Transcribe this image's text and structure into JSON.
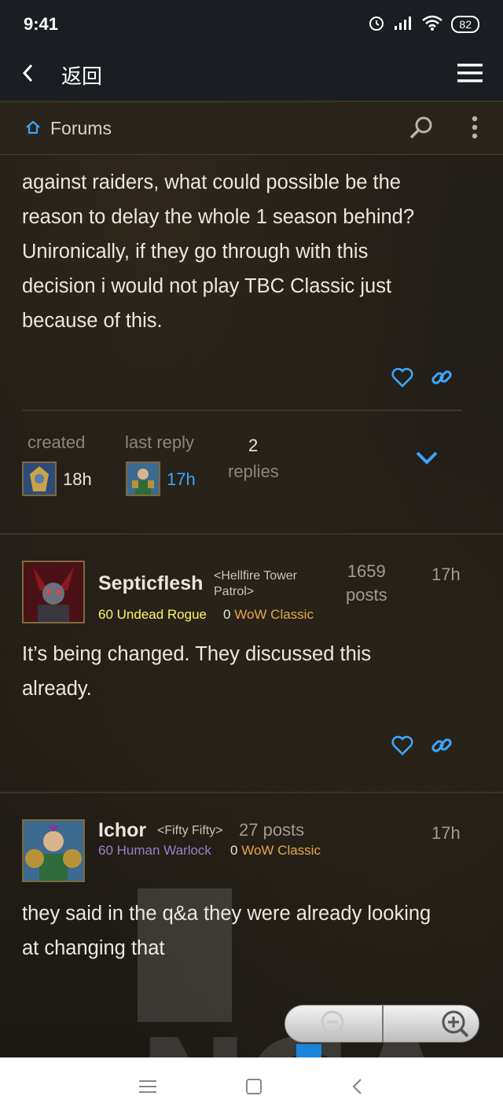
{
  "status_bar": {
    "time": "9:41",
    "battery": "82"
  },
  "app_bar": {
    "back_label": "返回"
  },
  "forum_bar": {
    "label": "Forums"
  },
  "post1": {
    "lines": [
      "against raiders, what could possible be the",
      "reason to delay the whole 1 season behind?",
      "Unironically, if they go through with this",
      "decision i would not play TBC Classic just",
      "because of this."
    ]
  },
  "topic_meta": {
    "created_label": "created",
    "created_time": "18h",
    "last_reply_label": "last reply",
    "last_reply_time": "17h",
    "replies_count": "2",
    "replies_label": "replies"
  },
  "post2": {
    "author": "Septicflesh",
    "guild_line1": "<Hellfire Tower",
    "guild_line2": "Patrol>",
    "posts_count": "1659",
    "posts_label": "posts",
    "time": "17h",
    "class_line": "60 Undead Rogue",
    "achievements": "0",
    "game": "WoW Classic",
    "class_color": "#fff569",
    "lines": [
      "It’s being changed. They discussed this",
      "already."
    ]
  },
  "post3": {
    "author": "Ichor",
    "guild": "<Fifty Fifty>",
    "posts": "27 posts",
    "time": "17h",
    "class_line": "60 Human Warlock",
    "achievements": "0",
    "game": "WoW Classic",
    "class_color": "#9482c9",
    "lines": [
      "they said in the q&a they were already looking",
      "at changing that"
    ]
  },
  "watermark": {
    "text": "NGA"
  },
  "colors": {
    "link_blue": "#3aa6ff",
    "game_orange": "#e7a64c"
  }
}
